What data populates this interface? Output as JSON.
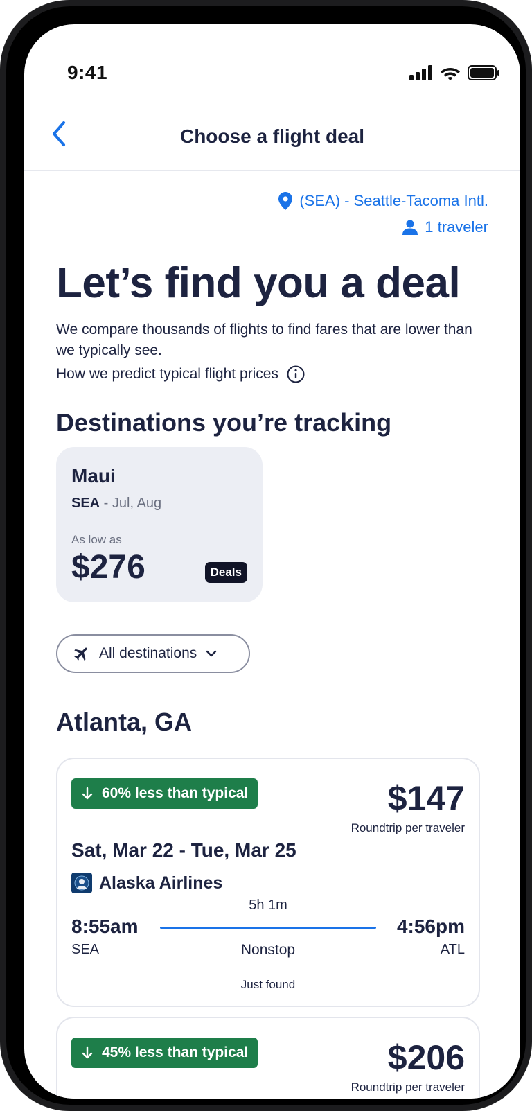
{
  "status": {
    "time": "9:41"
  },
  "nav": {
    "title": "Choose a flight deal"
  },
  "meta": {
    "airport": "(SEA) - Seattle-Tacoma Intl.",
    "travelers": "1 traveler"
  },
  "hero": {
    "title": "Let’s find you a deal",
    "description": "We compare thousands of flights to find fares that are lower than we typically see.",
    "predict_link": "How we predict typical flight prices"
  },
  "tracking": {
    "heading": "Destinations you’re tracking",
    "card": {
      "name": "Maui",
      "origin": "SEA",
      "months": " - Jul, Aug",
      "low_label": "As low as",
      "price": "$276",
      "badge": "Deals"
    }
  },
  "filter": {
    "label": "All destinations"
  },
  "city": "Atlanta, GA",
  "flights": [
    {
      "savings": "60% less than typical",
      "price": "$147",
      "price_note": "Roundtrip per traveler",
      "dates": "Sat, Mar 22 - Tue, Mar 25",
      "airline": "Alaska Airlines",
      "duration": "5h 1m",
      "depart_time": "8:55am",
      "arrive_time": "4:56pm",
      "depart_code": "SEA",
      "arrive_code": "ATL",
      "stops": "Nonstop",
      "found": "Just found"
    },
    {
      "savings": "45% less than typical",
      "price": "$206",
      "price_note": "Roundtrip per traveler"
    }
  ],
  "colors": {
    "accent": "#1a73e8",
    "savings": "#1e7e4a",
    "text": "#1d2340"
  }
}
